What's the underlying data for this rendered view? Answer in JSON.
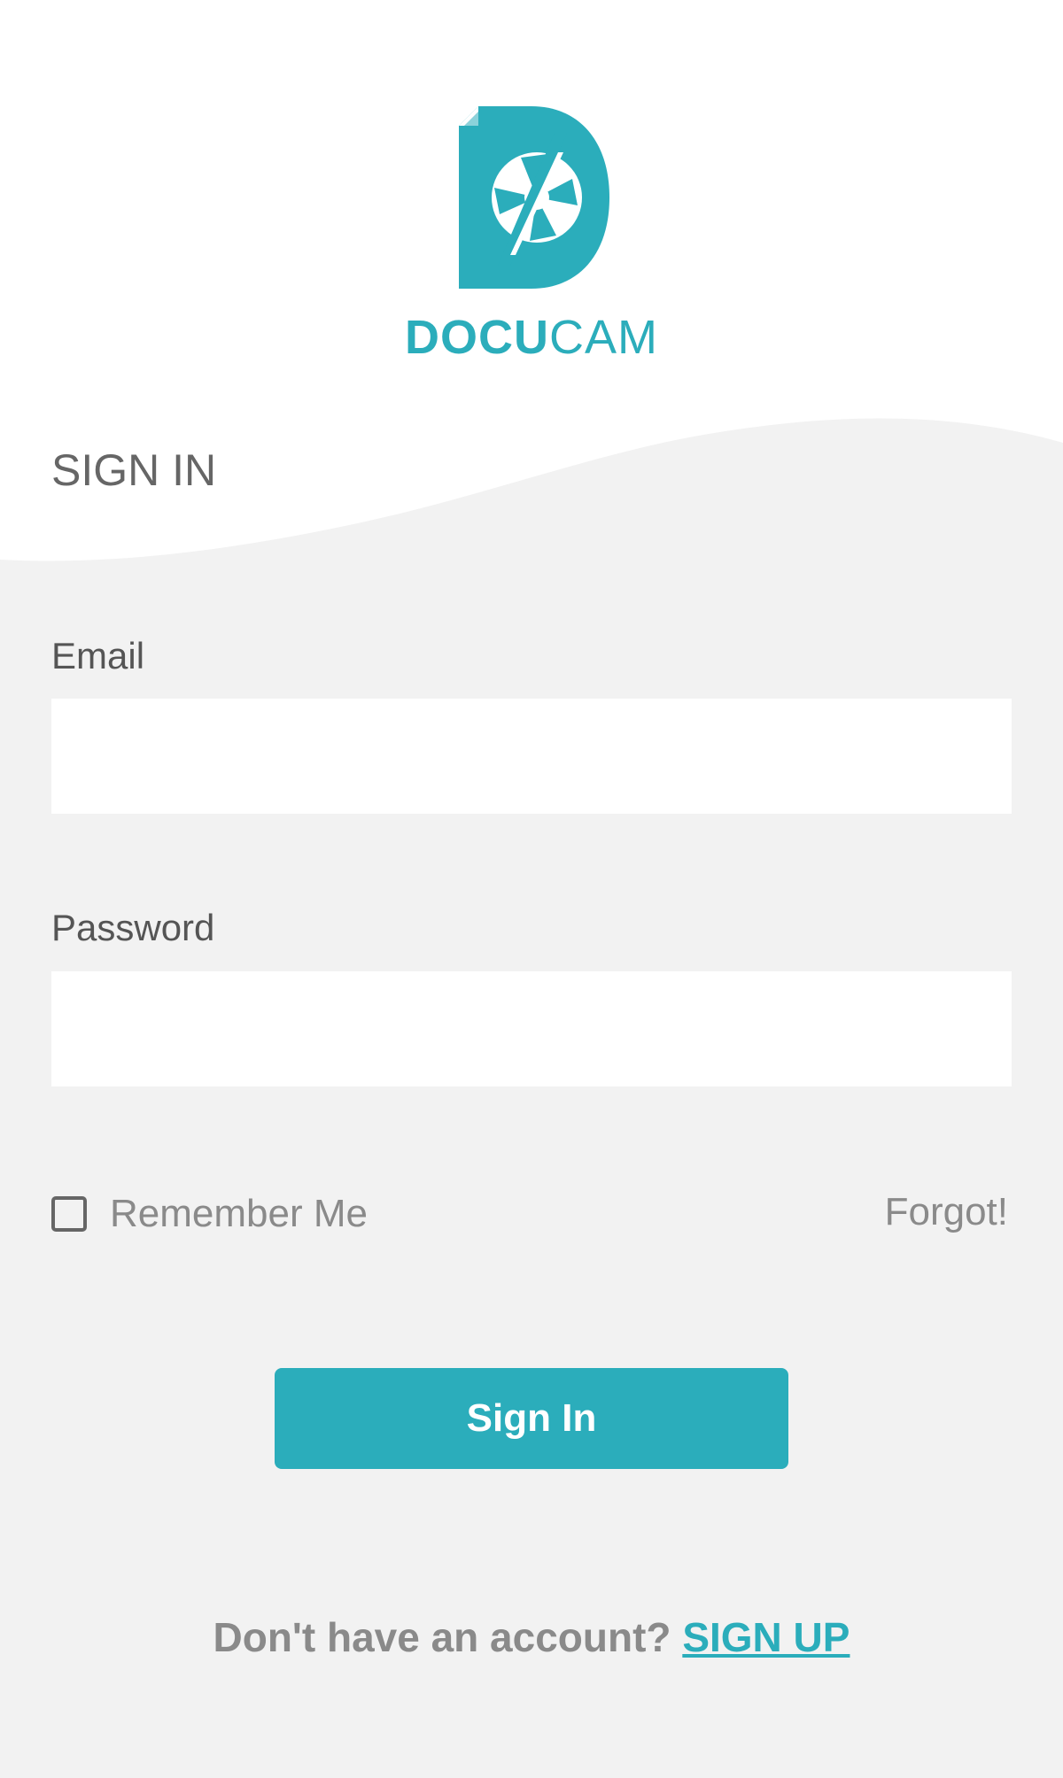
{
  "app": {
    "brand_bold": "DOCU",
    "brand_light": "CAM",
    "accent_color": "#2badbb",
    "logo_icon": "docucam-logo-icon"
  },
  "header": {
    "title": "SIGN IN"
  },
  "form": {
    "email_label": "Email",
    "email_value": "",
    "password_label": "Password",
    "password_value": "",
    "remember_label": "Remember Me",
    "remember_checked": false,
    "forgot_label": "Forgot!",
    "submit_label": "Sign In"
  },
  "footer": {
    "prompt": "Don't have an account?",
    "signup_label": "SIGN UP"
  }
}
